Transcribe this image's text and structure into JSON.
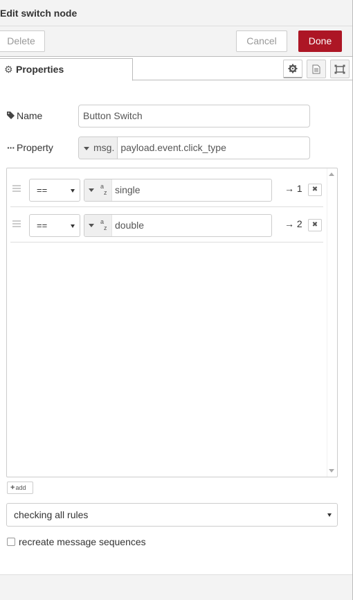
{
  "header": {
    "title": "Edit switch node"
  },
  "toolbar": {
    "delete_label": "Delete",
    "cancel_label": "Cancel",
    "done_label": "Done"
  },
  "colors": {
    "done_button": "#ad1625",
    "header_bg": "#f3f3f3"
  },
  "tabs": {
    "active_label": "Properties",
    "icons": [
      "gear-icon",
      "description-icon",
      "appearance-icon"
    ]
  },
  "form": {
    "name_label": "Name",
    "name_value": "Button Switch",
    "property_label": "Property",
    "property_type": "msg.",
    "property_value": "payload.event.click_type"
  },
  "rules": [
    {
      "operator": "==",
      "value_type": "string",
      "value": "single",
      "output": "→ 1"
    },
    {
      "operator": "==",
      "value_type": "string",
      "value": "double",
      "output": "→ 2"
    }
  ],
  "add_label": "add",
  "checking_mode": "checking all rules",
  "recreate_label": "recreate message sequences",
  "recreate_checked": false
}
